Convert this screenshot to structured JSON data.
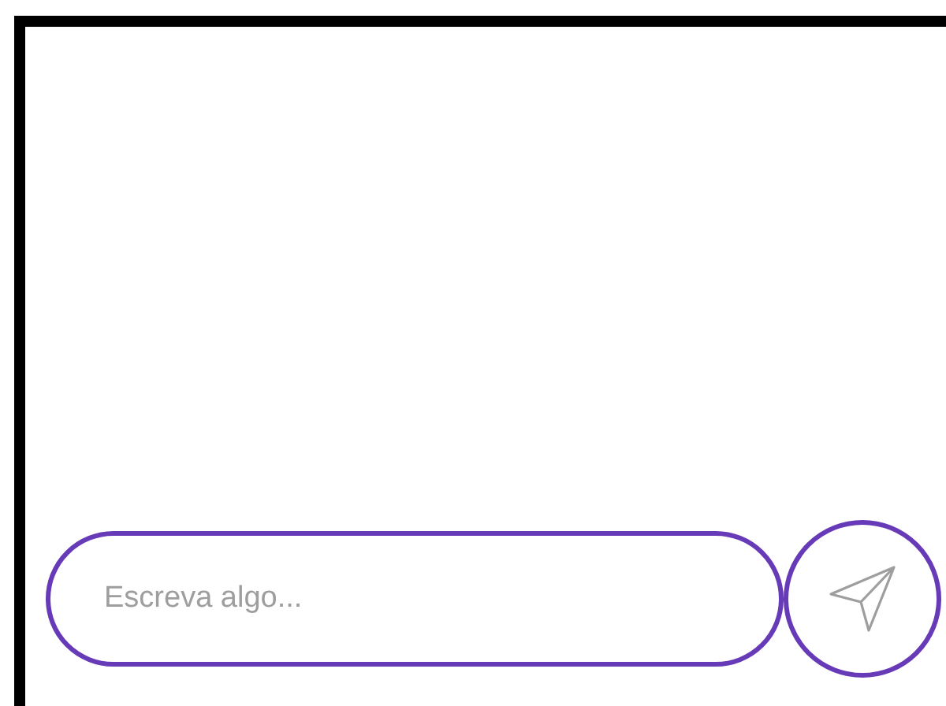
{
  "composer": {
    "placeholder": "Escreva algo..."
  }
}
